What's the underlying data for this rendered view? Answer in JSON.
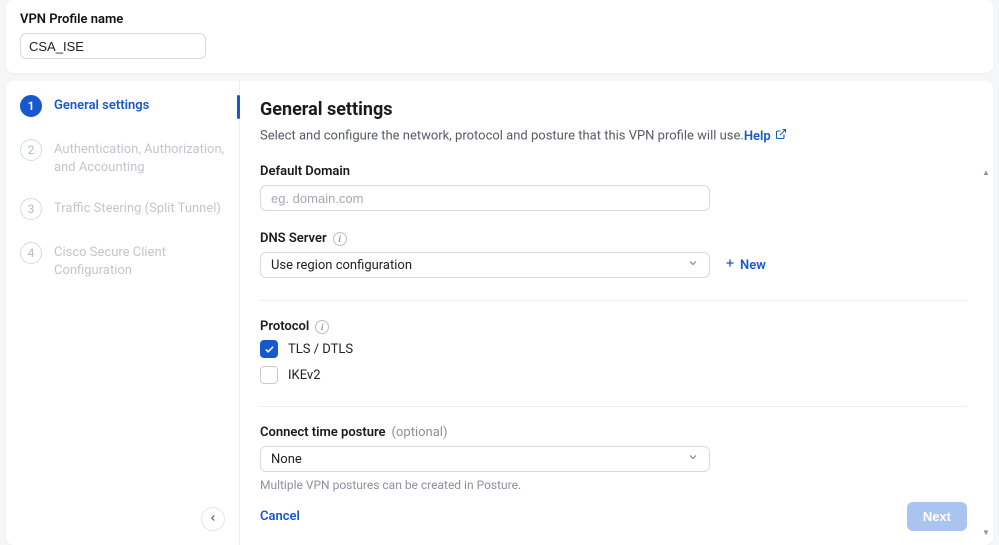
{
  "profile": {
    "label": "VPN Profile name",
    "value": "CSA_ISE"
  },
  "steps": [
    {
      "num": "1",
      "label": "General settings"
    },
    {
      "num": "2",
      "label": "Authentication, Authorization, and Accounting"
    },
    {
      "num": "3",
      "label": "Traffic Steering (Split Tunnel)"
    },
    {
      "num": "4",
      "label": "Cisco Secure Client Configuration"
    }
  ],
  "content": {
    "title": "General settings",
    "description": "Select and configure the network, protocol and posture that this VPN profile will use.",
    "help_label": "Help",
    "default_domain": {
      "label": "Default Domain",
      "placeholder": "eg. domain.com",
      "value": ""
    },
    "dns": {
      "label": "DNS Server",
      "selected": "Use region configuration",
      "new_label": "New"
    },
    "protocol": {
      "label": "Protocol",
      "options": [
        {
          "label": "TLS / DTLS",
          "checked": true
        },
        {
          "label": "IKEv2",
          "checked": false
        }
      ]
    },
    "posture": {
      "label": "Connect time posture",
      "optional": "(optional)",
      "selected": "None",
      "hint": "Multiple VPN postures can be created in Posture."
    }
  },
  "footer": {
    "cancel": "Cancel",
    "next": "Next"
  }
}
